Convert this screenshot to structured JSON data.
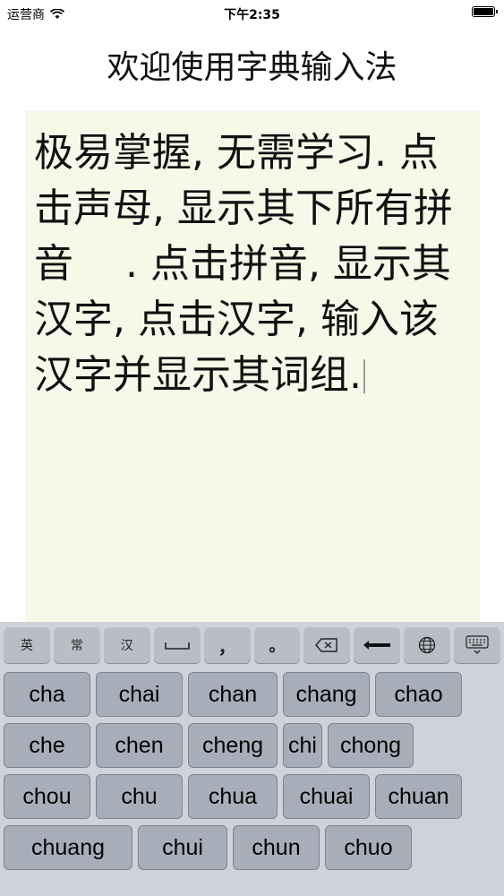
{
  "status_bar": {
    "carrier": "运营商",
    "time": "下午2:35"
  },
  "title": "欢迎使用字典输入法",
  "editor": {
    "text": "极易掌握, 无需学习. 点击声母, 显示其下所有拼音　 . 点击拼音, 显示其汉字,  点击汉字, 输入该汉字并显示其词组."
  },
  "toolbar": {
    "keys": [
      {
        "label": "英",
        "icon": "english-mode"
      },
      {
        "label": "常",
        "icon": "common-mode"
      },
      {
        "label": "汉",
        "icon": "chinese-mode"
      },
      {
        "label": "",
        "icon": "space-icon"
      },
      {
        "label": "，",
        "icon": "comma"
      },
      {
        "label": "。",
        "icon": "period"
      },
      {
        "label": "",
        "icon": "delete-icon"
      },
      {
        "label": "",
        "icon": "return-icon"
      },
      {
        "label": "",
        "icon": "globe-icon"
      },
      {
        "label": "",
        "icon": "keyboard-hide-icon"
      }
    ]
  },
  "pinyin": {
    "rows": [
      [
        "cha",
        "chai",
        "chan",
        "chang",
        "chao"
      ],
      [
        "che",
        "chen",
        "cheng",
        "chi",
        "chong"
      ],
      [
        "chou",
        "chu",
        "chua",
        "chuai",
        "chuan"
      ],
      [
        "chuang",
        "chui",
        "chun",
        "chuo"
      ]
    ]
  }
}
